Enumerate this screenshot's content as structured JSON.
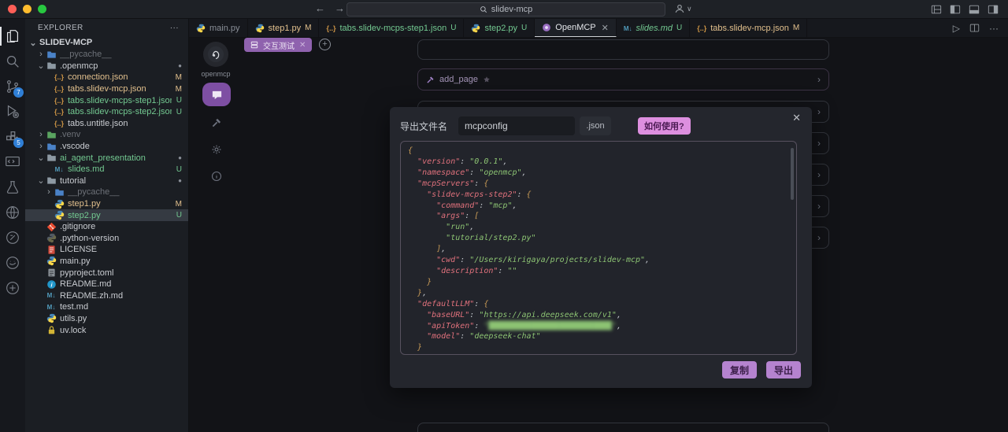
{
  "window": {
    "command_center": "slidev-mcp"
  },
  "activity_bar": {
    "items": [
      {
        "name": "explorer",
        "icon": "files",
        "active": true
      },
      {
        "name": "search",
        "icon": "search"
      },
      {
        "name": "source-control",
        "icon": "scm",
        "badge": "7"
      },
      {
        "name": "run-debug",
        "icon": "debug"
      },
      {
        "name": "extensions",
        "icon": "extensions",
        "badge": "5"
      },
      {
        "name": "remote-explorer",
        "icon": "remote"
      },
      {
        "name": "testing",
        "icon": "beaker"
      },
      {
        "name": "extension-globe",
        "icon": "globe"
      },
      {
        "name": "extension-circle-1",
        "icon": "circ1"
      },
      {
        "name": "extension-circle-2",
        "icon": "circ2"
      },
      {
        "name": "extension-circle-3",
        "icon": "circ3"
      }
    ]
  },
  "sidebar": {
    "header": "EXPLORER",
    "root": "SLIDEV-MCP",
    "items": [
      {
        "label": "__pycache__",
        "icon": "folder-blue",
        "caret": "closed",
        "indent": 1,
        "color": "ignored"
      },
      {
        "label": ".openmcp",
        "icon": "folder-gray",
        "caret": "open",
        "indent": 1,
        "color": "normal",
        "badge": "dot"
      },
      {
        "label": "connection.json",
        "icon": "json",
        "indent": 2,
        "color": "modified",
        "badge": "M"
      },
      {
        "label": "tabs.slidev-mcp.json",
        "icon": "json",
        "indent": 2,
        "color": "modified",
        "badge": "M"
      },
      {
        "label": "tabs.slidev-mcps-step1.json",
        "icon": "json",
        "indent": 2,
        "color": "untracked",
        "badge": "U"
      },
      {
        "label": "tabs.slidev-mcps-step2.json",
        "icon": "json",
        "indent": 2,
        "color": "untracked",
        "badge": "U"
      },
      {
        "label": "tabs.untitle.json",
        "icon": "json",
        "indent": 2,
        "color": "normal"
      },
      {
        "label": ".venv",
        "icon": "folder-green",
        "caret": "closed",
        "indent": 1,
        "color": "ignored"
      },
      {
        "label": ".vscode",
        "icon": "folder-blue",
        "caret": "closed",
        "indent": 1,
        "color": "normal"
      },
      {
        "label": "ai_agent_presentation",
        "icon": "folder-gray",
        "caret": "open",
        "indent": 1,
        "color": "untracked",
        "badge": "dot"
      },
      {
        "label": "slides.md",
        "icon": "markdown",
        "indent": 2,
        "color": "untracked",
        "badge": "U"
      },
      {
        "label": "tutorial",
        "icon": "folder-gray",
        "caret": "open",
        "indent": 1,
        "color": "normal",
        "badge": "dot"
      },
      {
        "label": "__pycache__",
        "icon": "folder-blue",
        "caret": "closed",
        "indent": 2,
        "color": "ignored"
      },
      {
        "label": "step1.py",
        "icon": "python",
        "indent": 2,
        "color": "modified",
        "badge": "M"
      },
      {
        "label": "step2.py",
        "icon": "python",
        "indent": 2,
        "color": "untracked",
        "badge": "U",
        "selected": true
      },
      {
        "label": ".gitignore",
        "icon": "git",
        "indent": 1,
        "color": "normal"
      },
      {
        "label": ".python-version",
        "icon": "python-dim",
        "indent": 1,
        "color": "normal"
      },
      {
        "label": "LICENSE",
        "icon": "license",
        "indent": 1,
        "color": "normal"
      },
      {
        "label": "main.py",
        "icon": "python",
        "indent": 1,
        "color": "normal"
      },
      {
        "label": "pyproject.toml",
        "icon": "toml",
        "indent": 1,
        "color": "normal"
      },
      {
        "label": "README.md",
        "icon": "info",
        "indent": 1,
        "color": "normal"
      },
      {
        "label": "README.zh.md",
        "icon": "markdown",
        "indent": 1,
        "color": "normal"
      },
      {
        "label": "test.md",
        "icon": "markdown",
        "indent": 1,
        "color": "normal"
      },
      {
        "label": "utils.py",
        "icon": "python",
        "indent": 1,
        "color": "normal"
      },
      {
        "label": "uv.lock",
        "icon": "lock",
        "indent": 1,
        "color": "normal"
      }
    ]
  },
  "tabs": [
    {
      "label": "main.py",
      "icon": "python",
      "color": "dim"
    },
    {
      "label": "step1.py",
      "icon": "python",
      "badge": "M",
      "color": "modified"
    },
    {
      "label": "tabs.slidev-mcps-step1.json",
      "icon": "json",
      "badge": "U",
      "color": "untracked"
    },
    {
      "label": "step2.py",
      "icon": "python",
      "badge": "U",
      "color": "untracked"
    },
    {
      "label": "OpenMCP",
      "icon": "openmcp",
      "close": true,
      "active": true,
      "color": "normal"
    },
    {
      "label": "slides.md",
      "icon": "markdown",
      "badge": "U",
      "color": "untracked",
      "italic": true
    },
    {
      "label": "tabs.slidev-mcp.json",
      "icon": "json",
      "badge": "M",
      "color": "modified"
    }
  ],
  "editor": {
    "logo_label": "openmcp",
    "session_tag": "交互测试",
    "tool_rows": {
      "named_label": "add_page",
      "hidden_row_count": 5
    }
  },
  "modal": {
    "filename_label": "导出文件名",
    "filename_value": "mcpconfig",
    "ext_label": ".json",
    "help_button": "如何使用?",
    "copy_button": "复制",
    "export_button": "导出",
    "code_lines": [
      [
        [
          "b",
          "{"
        ]
      ],
      [
        [
          "w",
          "  "
        ],
        [
          "k",
          "\"version\""
        ],
        [
          "p",
          ": "
        ],
        [
          "s",
          "\"0.0.1\""
        ],
        [
          "p",
          ","
        ]
      ],
      [
        [
          "w",
          "  "
        ],
        [
          "k",
          "\"namespace\""
        ],
        [
          "p",
          ": "
        ],
        [
          "s",
          "\"openmcp\""
        ],
        [
          "p",
          ","
        ]
      ],
      [
        [
          "w",
          "  "
        ],
        [
          "k",
          "\"mcpServers\""
        ],
        [
          "p",
          ": "
        ],
        [
          "b",
          "{"
        ]
      ],
      [
        [
          "w",
          "    "
        ],
        [
          "k",
          "\"slidev-mcps-step2\""
        ],
        [
          "p",
          ": "
        ],
        [
          "b",
          "{"
        ]
      ],
      [
        [
          "w",
          "      "
        ],
        [
          "k",
          "\"command\""
        ],
        [
          "p",
          ": "
        ],
        [
          "s",
          "\"mcp\""
        ],
        [
          "p",
          ","
        ]
      ],
      [
        [
          "w",
          "      "
        ],
        [
          "k",
          "\"args\""
        ],
        [
          "p",
          ": "
        ],
        [
          "b",
          "["
        ]
      ],
      [
        [
          "w",
          "        "
        ],
        [
          "s",
          "\"run\""
        ],
        [
          "p",
          ","
        ]
      ],
      [
        [
          "w",
          "        "
        ],
        [
          "s",
          "\"tutorial/step2.py\""
        ]
      ],
      [
        [
          "w",
          "      "
        ],
        [
          "b",
          "]"
        ],
        [
          "p",
          ","
        ]
      ],
      [
        [
          "w",
          "      "
        ],
        [
          "k",
          "\"cwd\""
        ],
        [
          "p",
          ": "
        ],
        [
          "s",
          "\"/Users/kirigaya/projects/slidev-mcp\""
        ],
        [
          "p",
          ","
        ]
      ],
      [
        [
          "w",
          "      "
        ],
        [
          "k",
          "\"description\""
        ],
        [
          "p",
          ": "
        ],
        [
          "s",
          "\"\""
        ]
      ],
      [
        [
          "w",
          "    "
        ],
        [
          "b",
          "}"
        ]
      ],
      [
        [
          "w",
          "  "
        ],
        [
          "b",
          "}"
        ],
        [
          "p",
          ","
        ]
      ],
      [
        [
          "w",
          "  "
        ],
        [
          "k",
          "\"defaultLLM\""
        ],
        [
          "p",
          ": "
        ],
        [
          "b",
          "{"
        ]
      ],
      [
        [
          "w",
          "    "
        ],
        [
          "k",
          "\"baseURL\""
        ],
        [
          "p",
          ": "
        ],
        [
          "s",
          "\"https://api.deepseek.com/v1\""
        ],
        [
          "p",
          ","
        ]
      ],
      [
        [
          "w",
          "    "
        ],
        [
          "k",
          "\"apiToken\""
        ],
        [
          "p",
          ": "
        ],
        [
          "r",
          "\"██████████████████████████\""
        ],
        [
          "p",
          ","
        ]
      ],
      [
        [
          "w",
          "    "
        ],
        [
          "k",
          "\"model\""
        ],
        [
          "p",
          ": "
        ],
        [
          "s",
          "\"deepseek-chat\""
        ]
      ],
      [
        [
          "w",
          "  "
        ],
        [
          "b",
          "}"
        ]
      ]
    ]
  },
  "colors": {
    "accent_purple": "#8f62ae",
    "button_purple": "#b583cf",
    "help_pink": "#dd8fdf",
    "modified": "#e2c08d",
    "untracked": "#73c991",
    "badge_blue": "#2f7fd6"
  }
}
